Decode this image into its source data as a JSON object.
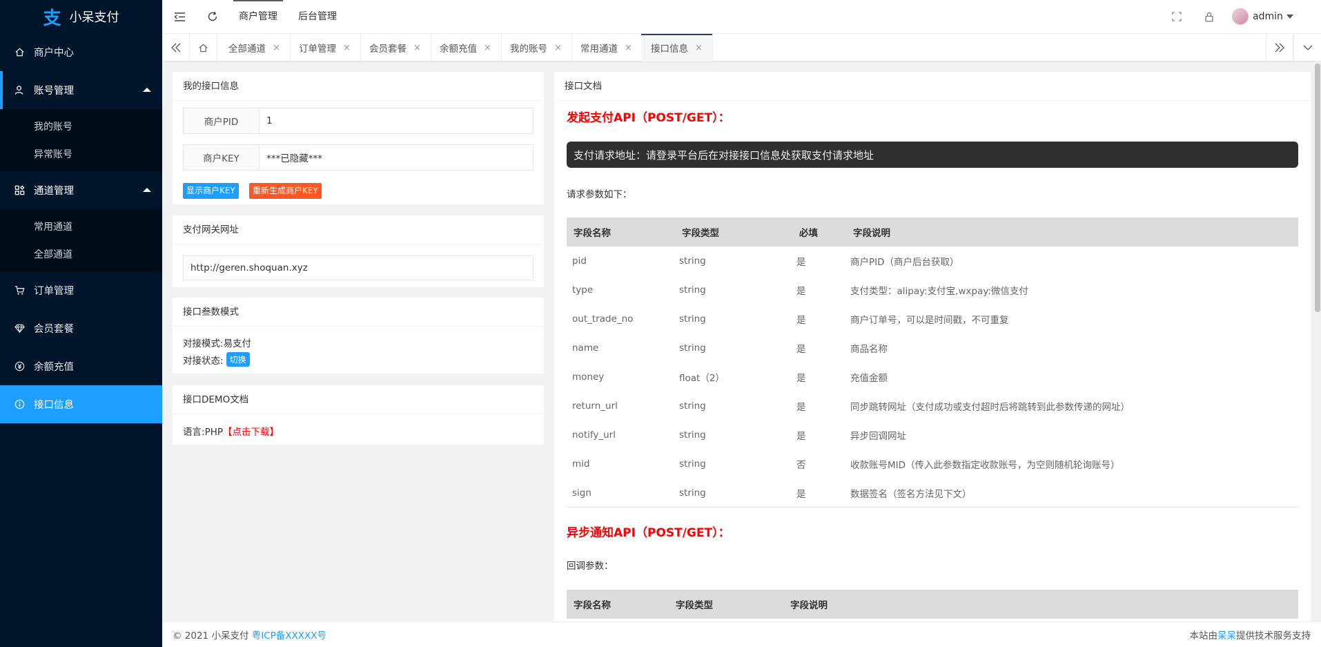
{
  "app": {
    "logo_glyph": "支",
    "name": "小呆支付"
  },
  "sidebar": {
    "items": [
      {
        "label": "商户中心",
        "icon": "home-icon"
      },
      {
        "label": "账号管理",
        "icon": "user-icon",
        "children": [
          "我的账号",
          "异常账号"
        ]
      },
      {
        "label": "通道管理",
        "icon": "apps-icon",
        "children": [
          "常用通道",
          "全部通道"
        ]
      },
      {
        "label": "订单管理",
        "icon": "cart-icon"
      },
      {
        "label": "会员套餐",
        "icon": "diamond-icon"
      },
      {
        "label": "余额充值",
        "icon": "yen-icon"
      },
      {
        "label": "接口信息",
        "icon": "info-icon"
      }
    ]
  },
  "header": {
    "tabs": [
      "商户管理",
      "后台管理"
    ],
    "user": "admin"
  },
  "tabbar": {
    "tabs": [
      {
        "label": "全部通道"
      },
      {
        "label": "订单管理"
      },
      {
        "label": "会员套餐"
      },
      {
        "label": "余额充值"
      },
      {
        "label": "我的账号"
      },
      {
        "label": "常用通道"
      },
      {
        "label": "接口信息",
        "active": true
      }
    ],
    "close_glyph": "×"
  },
  "my_api": {
    "title": "我的接口信息",
    "pid_label": "商户PID",
    "pid_value": "1",
    "key_label": "商户KEY",
    "key_value": "***已隐藏***",
    "show_key_btn": "显示商户KEY",
    "regen_key_btn": "重新生成商户KEY"
  },
  "gateway": {
    "title": "支付网关网址",
    "url": "http://geren.shoquan.xyz"
  },
  "param_mode": {
    "title": "接口叁数模式",
    "mode_label": "对接模式:",
    "mode_value": "易支付",
    "status_label": "对接状态:",
    "switch_btn": "切换"
  },
  "demo": {
    "title": "接口DEMO文档",
    "lang_label": "语言:",
    "lang_value": "PHP",
    "download": "【点击下载】"
  },
  "docs": {
    "title": "接口文档",
    "pay_api_title": "发起支付API（POST/GET）：",
    "pay_url_notice": "支付请求地址：请登录平台后在对接接口信息处获取支付请求地址",
    "request_params_label": "请求参数如下：",
    "headers": [
      "字段名称",
      "字段类型",
      "必填",
      "字段说明"
    ],
    "rows": [
      [
        "pid",
        "string",
        "是",
        "商户PID（商户后台获取）"
      ],
      [
        "type",
        "string",
        "是",
        "支付类型：alipay:支付宝,wxpay:微信支付"
      ],
      [
        "out_trade_no",
        "string",
        "是",
        "商户订单号，可以是时间戳，不可重复"
      ],
      [
        "name",
        "string",
        "是",
        "商品名称"
      ],
      [
        "money",
        "float（2）",
        "是",
        "充值金额"
      ],
      [
        "return_url",
        "string",
        "是",
        "同步跳转网址（支付成功或支付超时后将跳转到此参数传递的网址）"
      ],
      [
        "notify_url",
        "string",
        "是",
        "异步回调网址"
      ],
      [
        "mid",
        "string",
        "否",
        "收款账号MID（传入此参数指定收款账号，为空则随机轮询账号）"
      ],
      [
        "sign",
        "string",
        "是",
        "数据签名（签名方法见下文）"
      ]
    ],
    "notify_api_title": "异步通知API（POST/GET）：",
    "callback_params_label": "回调参数：",
    "notify_headers": [
      "字段名称",
      "字段类型",
      "字段说明"
    ]
  },
  "footer": {
    "copyright": "© 2021 小呆支付",
    "icp": "粤ICP备XXXXX号",
    "support_pre": "本站由",
    "support_link": "呆呆",
    "support_post": "提供技术服务支持"
  },
  "colors": {
    "sidebar_bg": "#001529",
    "accent": "#1e9fff",
    "danger": "#ff5722",
    "doc_title": "#ff0000"
  }
}
